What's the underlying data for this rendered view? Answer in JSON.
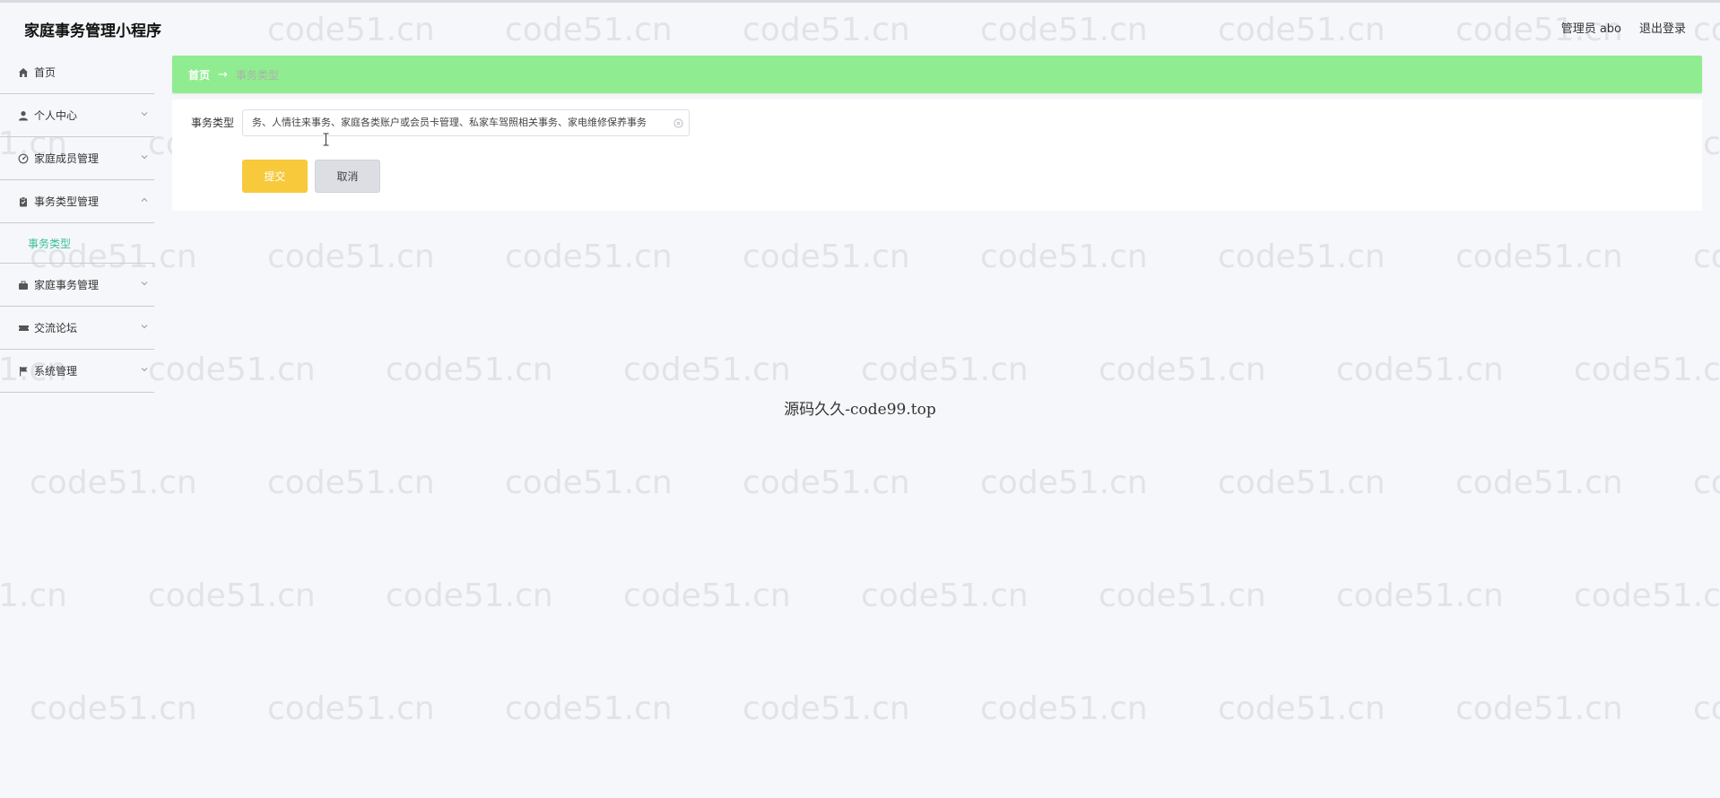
{
  "app_title": "家庭事务管理小程序",
  "header": {
    "user_label": "管理员 abo",
    "logout_label": "退出登录"
  },
  "watermark": {
    "text": "code51.cn",
    "left_cut_text": "1.cn"
  },
  "sidebar": {
    "items": [
      {
        "label": "首页",
        "icon": "home-icon"
      },
      {
        "label": "个人中心",
        "icon": "user-icon"
      },
      {
        "label": "家庭成员管理",
        "icon": "dashboard-icon"
      },
      {
        "label": "事务类型管理",
        "icon": "clipboard-icon",
        "expanded": true,
        "children": [
          {
            "label": "事务类型",
            "active": true
          }
        ]
      },
      {
        "label": "家庭事务管理",
        "icon": "briefcase-icon"
      },
      {
        "label": "交流论坛",
        "icon": "ticket-icon"
      },
      {
        "label": "系统管理",
        "icon": "flag-icon"
      }
    ]
  },
  "breadcrumb": {
    "home": "首页",
    "separator": "→",
    "current": "事务类型"
  },
  "form": {
    "label": "事务类型",
    "value": "务、人情往来事务、家庭各类账户或会员卡管理、私家车驾照相关事务、家电维修保养事务",
    "submit_label": "提交",
    "cancel_label": "取消"
  },
  "footer_text": "源码久久-code99.top",
  "colors": {
    "breadcrumb_bg": "#90ec90",
    "active_menu": "#3bbf9a",
    "submit_button": "#f7c93b",
    "cancel_button": "#dcdee3",
    "page_bg": "#f6f7fa"
  }
}
